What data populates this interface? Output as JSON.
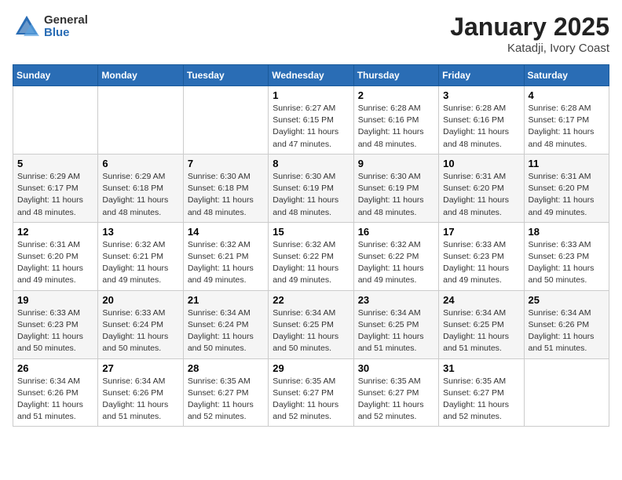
{
  "header": {
    "logo": {
      "general": "General",
      "blue": "Blue"
    },
    "title": "January 2025",
    "location": "Katadji, Ivory Coast"
  },
  "weekdays": [
    "Sunday",
    "Monday",
    "Tuesday",
    "Wednesday",
    "Thursday",
    "Friday",
    "Saturday"
  ],
  "weeks": [
    [
      {
        "day": "",
        "info": ""
      },
      {
        "day": "",
        "info": ""
      },
      {
        "day": "",
        "info": ""
      },
      {
        "day": "1",
        "info": "Sunrise: 6:27 AM\nSunset: 6:15 PM\nDaylight: 11 hours\nand 47 minutes."
      },
      {
        "day": "2",
        "info": "Sunrise: 6:28 AM\nSunset: 6:16 PM\nDaylight: 11 hours\nand 48 minutes."
      },
      {
        "day": "3",
        "info": "Sunrise: 6:28 AM\nSunset: 6:16 PM\nDaylight: 11 hours\nand 48 minutes."
      },
      {
        "day": "4",
        "info": "Sunrise: 6:28 AM\nSunset: 6:17 PM\nDaylight: 11 hours\nand 48 minutes."
      }
    ],
    [
      {
        "day": "5",
        "info": "Sunrise: 6:29 AM\nSunset: 6:17 PM\nDaylight: 11 hours\nand 48 minutes."
      },
      {
        "day": "6",
        "info": "Sunrise: 6:29 AM\nSunset: 6:18 PM\nDaylight: 11 hours\nand 48 minutes."
      },
      {
        "day": "7",
        "info": "Sunrise: 6:30 AM\nSunset: 6:18 PM\nDaylight: 11 hours\nand 48 minutes."
      },
      {
        "day": "8",
        "info": "Sunrise: 6:30 AM\nSunset: 6:19 PM\nDaylight: 11 hours\nand 48 minutes."
      },
      {
        "day": "9",
        "info": "Sunrise: 6:30 AM\nSunset: 6:19 PM\nDaylight: 11 hours\nand 48 minutes."
      },
      {
        "day": "10",
        "info": "Sunrise: 6:31 AM\nSunset: 6:20 PM\nDaylight: 11 hours\nand 48 minutes."
      },
      {
        "day": "11",
        "info": "Sunrise: 6:31 AM\nSunset: 6:20 PM\nDaylight: 11 hours\nand 49 minutes."
      }
    ],
    [
      {
        "day": "12",
        "info": "Sunrise: 6:31 AM\nSunset: 6:20 PM\nDaylight: 11 hours\nand 49 minutes."
      },
      {
        "day": "13",
        "info": "Sunrise: 6:32 AM\nSunset: 6:21 PM\nDaylight: 11 hours\nand 49 minutes."
      },
      {
        "day": "14",
        "info": "Sunrise: 6:32 AM\nSunset: 6:21 PM\nDaylight: 11 hours\nand 49 minutes."
      },
      {
        "day": "15",
        "info": "Sunrise: 6:32 AM\nSunset: 6:22 PM\nDaylight: 11 hours\nand 49 minutes."
      },
      {
        "day": "16",
        "info": "Sunrise: 6:32 AM\nSunset: 6:22 PM\nDaylight: 11 hours\nand 49 minutes."
      },
      {
        "day": "17",
        "info": "Sunrise: 6:33 AM\nSunset: 6:23 PM\nDaylight: 11 hours\nand 49 minutes."
      },
      {
        "day": "18",
        "info": "Sunrise: 6:33 AM\nSunset: 6:23 PM\nDaylight: 11 hours\nand 50 minutes."
      }
    ],
    [
      {
        "day": "19",
        "info": "Sunrise: 6:33 AM\nSunset: 6:23 PM\nDaylight: 11 hours\nand 50 minutes."
      },
      {
        "day": "20",
        "info": "Sunrise: 6:33 AM\nSunset: 6:24 PM\nDaylight: 11 hours\nand 50 minutes."
      },
      {
        "day": "21",
        "info": "Sunrise: 6:34 AM\nSunset: 6:24 PM\nDaylight: 11 hours\nand 50 minutes."
      },
      {
        "day": "22",
        "info": "Sunrise: 6:34 AM\nSunset: 6:25 PM\nDaylight: 11 hours\nand 50 minutes."
      },
      {
        "day": "23",
        "info": "Sunrise: 6:34 AM\nSunset: 6:25 PM\nDaylight: 11 hours\nand 51 minutes."
      },
      {
        "day": "24",
        "info": "Sunrise: 6:34 AM\nSunset: 6:25 PM\nDaylight: 11 hours\nand 51 minutes."
      },
      {
        "day": "25",
        "info": "Sunrise: 6:34 AM\nSunset: 6:26 PM\nDaylight: 11 hours\nand 51 minutes."
      }
    ],
    [
      {
        "day": "26",
        "info": "Sunrise: 6:34 AM\nSunset: 6:26 PM\nDaylight: 11 hours\nand 51 minutes."
      },
      {
        "day": "27",
        "info": "Sunrise: 6:34 AM\nSunset: 6:26 PM\nDaylight: 11 hours\nand 51 minutes."
      },
      {
        "day": "28",
        "info": "Sunrise: 6:35 AM\nSunset: 6:27 PM\nDaylight: 11 hours\nand 52 minutes."
      },
      {
        "day": "29",
        "info": "Sunrise: 6:35 AM\nSunset: 6:27 PM\nDaylight: 11 hours\nand 52 minutes."
      },
      {
        "day": "30",
        "info": "Sunrise: 6:35 AM\nSunset: 6:27 PM\nDaylight: 11 hours\nand 52 minutes."
      },
      {
        "day": "31",
        "info": "Sunrise: 6:35 AM\nSunset: 6:27 PM\nDaylight: 11 hours\nand 52 minutes."
      },
      {
        "day": "",
        "info": ""
      }
    ]
  ]
}
